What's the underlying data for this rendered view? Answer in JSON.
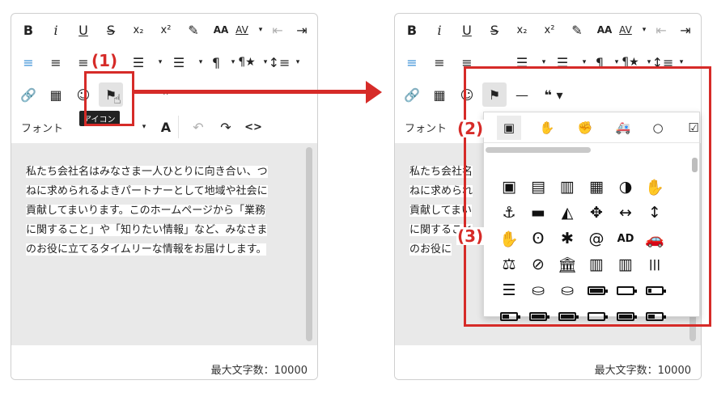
{
  "editor_left": {
    "toolbar": {
      "row1": [
        "B",
        "i",
        "U",
        "S̶",
        "x₂",
        "x²",
        "✎",
        "AA",
        "AV",
        "▾",
        "⇤",
        "⇥"
      ],
      "row2": [
        "≡",
        "≡",
        "≡",
        "☰",
        "▾",
        "☰",
        "▾",
        "¶",
        "▾",
        "¶★",
        "▾",
        "↕≡",
        "▾"
      ],
      "row3": [
        "🔗",
        "▦",
        "☺",
        "⚑",
        "❞"
      ],
      "font_label": "フォント",
      "row4_misc": [
        "▾",
        "A",
        "↶",
        "↷",
        "<>"
      ]
    },
    "tooltip": "アイコン",
    "text_lines": [
      "私たち会社名はみなさま一人ひとりに向き合い、つ",
      "ねに求められるよきパートナーとして地域や社会に",
      "貢献してまいります。このホームページから「業務",
      "に関すること」や「知りたい情報」など、みなさま",
      "のお役に立てるタイムリーな情報をお届けします。"
    ],
    "char_count": "最大文字数：10000"
  },
  "editor_right": {
    "font_label": "フォント",
    "text_lines": [
      "私たち会社名",
      "ねに求められ",
      "貢献してまい",
      "に関すること",
      "のお役に"
    ],
    "char_count": "最大文字数：10000",
    "row3_extra": [
      "—",
      "❝ ▾"
    ]
  },
  "annotations": {
    "label1": "(1)",
    "label2": "(2)",
    "label3": "(3)"
  },
  "icon_panel": {
    "category_tabs": [
      {
        "icon": "address-book",
        "glyph": "▣"
      },
      {
        "icon": "sign-language",
        "glyph": "✋"
      },
      {
        "icon": "hand",
        "glyph": "✊"
      },
      {
        "icon": "ambulance",
        "glyph": "🚑"
      },
      {
        "icon": "circle",
        "glyph": "○"
      },
      {
        "icon": "check-square",
        "glyph": "☑"
      }
    ],
    "icons": [
      [
        "▣",
        "▤",
        "▥",
        "▦",
        "◑",
        "✋"
      ],
      [
        "⚓",
        "▬",
        "◭",
        "✥",
        "↔",
        "↕"
      ],
      [
        "✋",
        "ʘ",
        "✱",
        "@",
        "AD",
        "🚗"
      ],
      [
        "⚖",
        "⊘",
        "🏛",
        "▥",
        "▥",
        "|||"
      ],
      [
        "☰",
        "⛀",
        "⛀",
        "battery-full",
        "battery-empty",
        "battery-quarter"
      ],
      [
        "battery-half",
        "battery-full",
        "battery-full",
        "battery-empty",
        "battery-full",
        "battery-half"
      ]
    ]
  },
  "colors": {
    "accent_red": "#d62b28",
    "align_blue": "#3a8fd6"
  }
}
